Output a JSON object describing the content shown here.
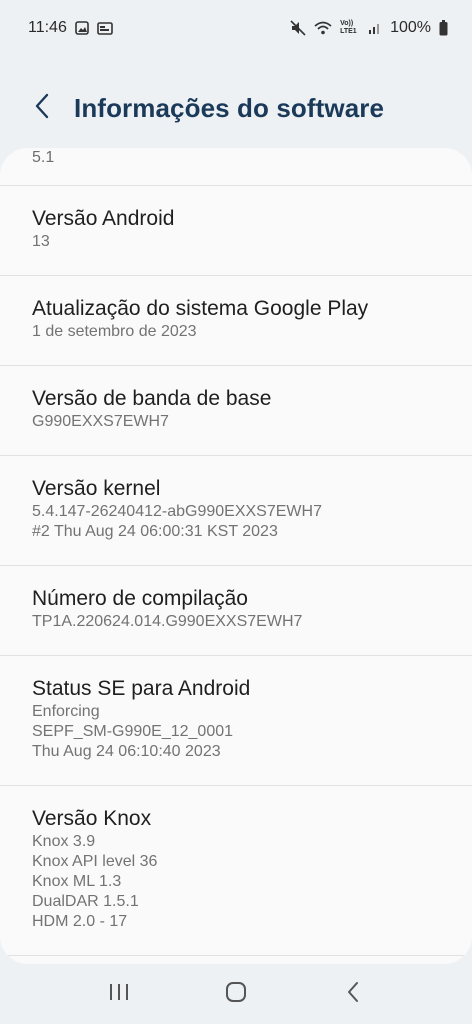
{
  "status": {
    "time": "11:46",
    "battery": "100%",
    "volte_label": "Vo)) LTE1",
    "icons": [
      "gallery-icon",
      "screen-icon",
      "mute-icon",
      "wifi-icon",
      "signal-icon",
      "battery-icon"
    ]
  },
  "header": {
    "title": "Informações do software",
    "back_icon": "chevron-left-icon"
  },
  "top_partial_value": "5.1",
  "items": [
    {
      "title": "Versão Android",
      "lines": [
        "13"
      ]
    },
    {
      "title": "Atualização do sistema Google Play",
      "lines": [
        "1 de setembro de 2023"
      ]
    },
    {
      "title": "Versão de banda de base",
      "lines": [
        "G990EXXS7EWH7"
      ]
    },
    {
      "title": "Versão kernel",
      "lines": [
        "5.4.147-26240412-abG990EXXS7EWH7",
        "#2 Thu Aug 24 06:00:31 KST 2023"
      ]
    },
    {
      "title": "Número de compilação",
      "lines": [
        "TP1A.220624.014.G990EXXS7EWH7"
      ]
    },
    {
      "title": "Status SE para Android",
      "lines": [
        "Enforcing",
        "SEPF_SM-G990E_12_0001",
        "Thu Aug 24 06:10:40 2023"
      ]
    },
    {
      "title": "Versão Knox",
      "lines": [
        "Knox 3.9",
        "Knox API level 36",
        "Knox ML 1.3",
        "DualDAR 1.5.1",
        "HDM 2.0 - 17"
      ]
    }
  ],
  "nav": {
    "icons": [
      "recent-apps-icon",
      "home-icon",
      "back-icon"
    ]
  },
  "colors": {
    "background": "#eef1f4",
    "card": "#fafafa",
    "title": "#1b3a5a",
    "secondary_text": "#737373",
    "divider": "#e1e1e1"
  }
}
